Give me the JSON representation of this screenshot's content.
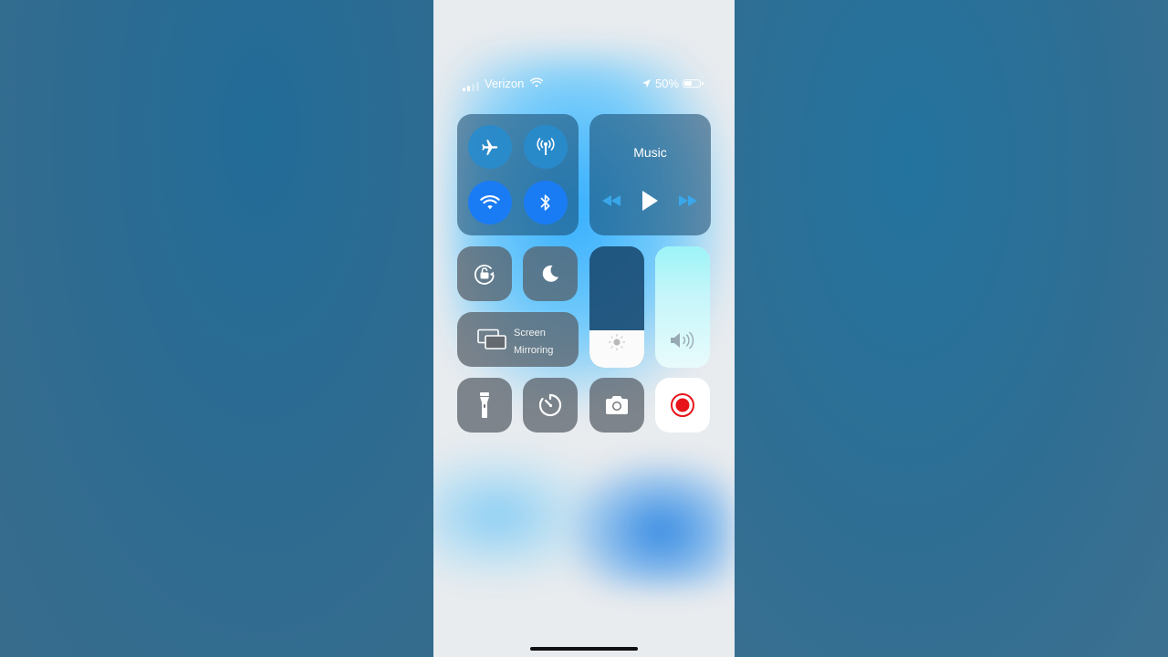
{
  "status_bar": {
    "carrier": "Verizon",
    "battery_percent_label": "50%",
    "battery_level": 0.5,
    "signal_bars_active": 2
  },
  "connectivity": {
    "airplane_mode": false,
    "cellular_data": false,
    "wifi": true,
    "bluetooth": true
  },
  "music": {
    "title": "Music"
  },
  "toggles": {
    "rotation_lock": false,
    "do_not_disturb": false
  },
  "screen_mirroring": {
    "label_line1": "Screen",
    "label_line2": "Mirroring"
  },
  "sliders": {
    "brightness_level": 0.31,
    "volume_level": 1.0
  },
  "colors": {
    "active_blue": "#1a7cf4",
    "record_red": "#e8141b"
  },
  "shortcuts": {
    "screen_recording": true
  }
}
